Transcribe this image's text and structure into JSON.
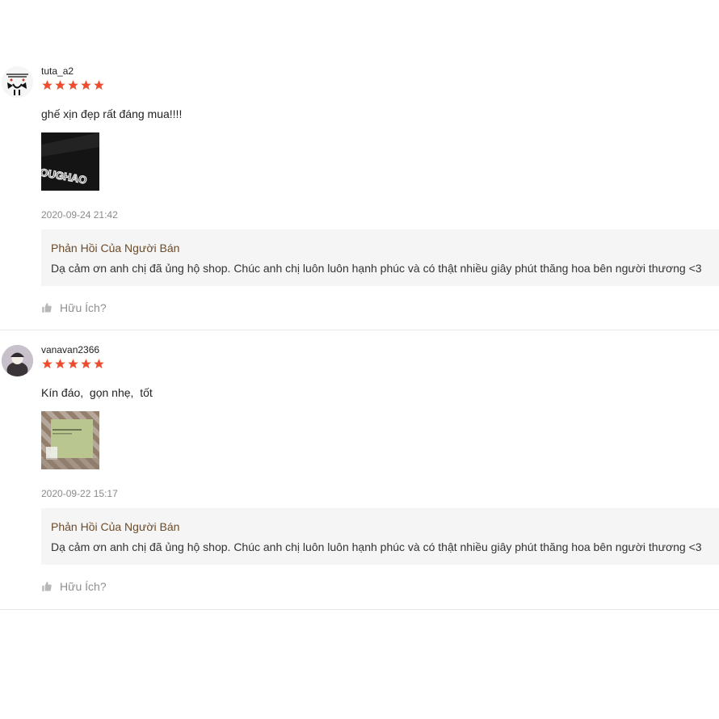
{
  "reviews": [
    {
      "author": "tuta_a2",
      "rating": 5,
      "comment": "ghế xịn đẹp rất đáng mua!!!!",
      "photo_text": "OUGHAO",
      "time": "2020-09-24 21:42",
      "reply_title": "Phản Hồi Của Người Bán",
      "reply_text": "Dạ cảm ơn anh chị đã ủng hộ shop. Chúc anh chị luôn luôn hạnh phúc và có thật nhiều giây phút thăng hoa bên người thương <3",
      "helpful_label": "Hữu Ích?"
    },
    {
      "author": "vanavan2366",
      "rating": 5,
      "comment": "Kín đáo,  gọn nhẹ,  tốt",
      "photo_text": "",
      "time": "2020-09-22 15:17",
      "reply_title": "Phản Hồi Của Người Bán",
      "reply_text": "Dạ cảm ơn anh chị đã ủng hộ shop. Chúc anh chị luôn luôn hạnh phúc và có thật nhiều giây phút thăng hoa bên người thương <3",
      "helpful_label": "Hữu Ích?"
    }
  ],
  "colors": {
    "star": "#ee4d2d",
    "reply_title": "#6b4b2a",
    "muted": "#8f8f8f"
  },
  "icons": {
    "star": "star-icon",
    "helpful": "thumbs-up-icon"
  }
}
